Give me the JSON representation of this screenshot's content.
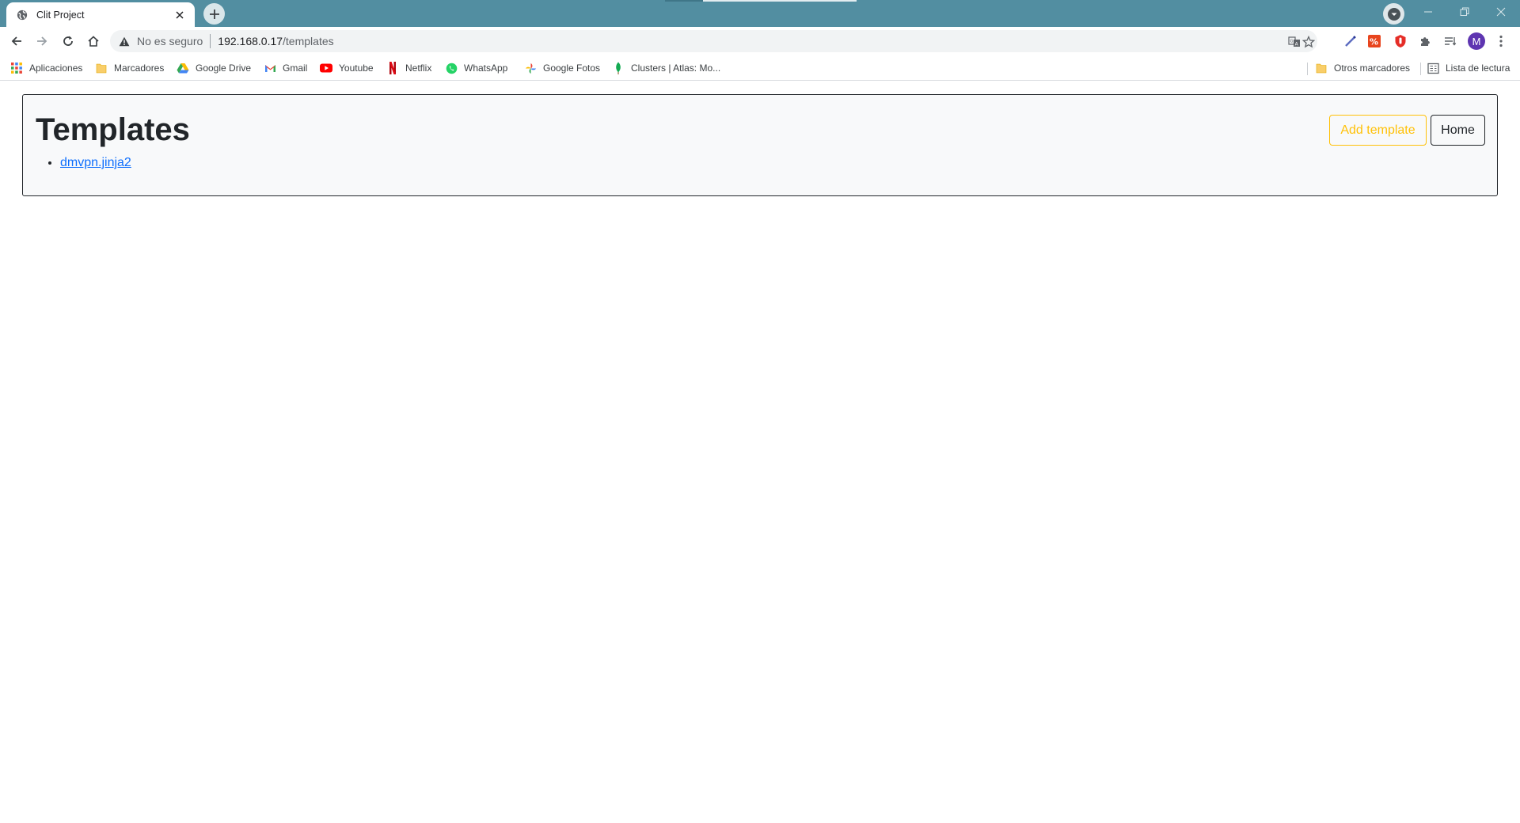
{
  "browser": {
    "tab": {
      "title": "Clit Project"
    },
    "address": {
      "security_label": "No es seguro",
      "url_host": "192.168.0.17",
      "url_path": "/templates"
    },
    "bookmarks": [
      {
        "label": "Aplicaciones",
        "icon": "apps-grid-icon"
      },
      {
        "label": "Marcadores",
        "icon": "folder-icon"
      },
      {
        "label": "Google Drive",
        "icon": "google-drive-icon"
      },
      {
        "label": "Gmail",
        "icon": "gmail-icon"
      },
      {
        "label": "Youtube",
        "icon": "youtube-icon"
      },
      {
        "label": "Netflix",
        "icon": "netflix-icon"
      },
      {
        "label": "WhatsApp",
        "icon": "whatsapp-icon"
      },
      {
        "label": "Google Fotos",
        "icon": "google-photos-icon"
      },
      {
        "label": "Clusters | Atlas: Mo...",
        "icon": "mongodb-leaf-icon"
      }
    ],
    "other_bookmarks": {
      "label": "Otros marcadores"
    },
    "reading_list": {
      "label": "Lista de lectura"
    },
    "profile_initial": "M",
    "colors": {
      "tabstrip": "#528ea1",
      "profile_avatar": "#5e35b1"
    }
  },
  "page": {
    "title": "Templates",
    "templates": [
      "dmvpn.jinja2"
    ],
    "buttons": {
      "add_template": "Add template",
      "home": "Home"
    },
    "colors": {
      "warning": "#ffc107",
      "link": "#0d6efd",
      "dark": "#212529",
      "card_bg": "#f8f9fa"
    }
  }
}
